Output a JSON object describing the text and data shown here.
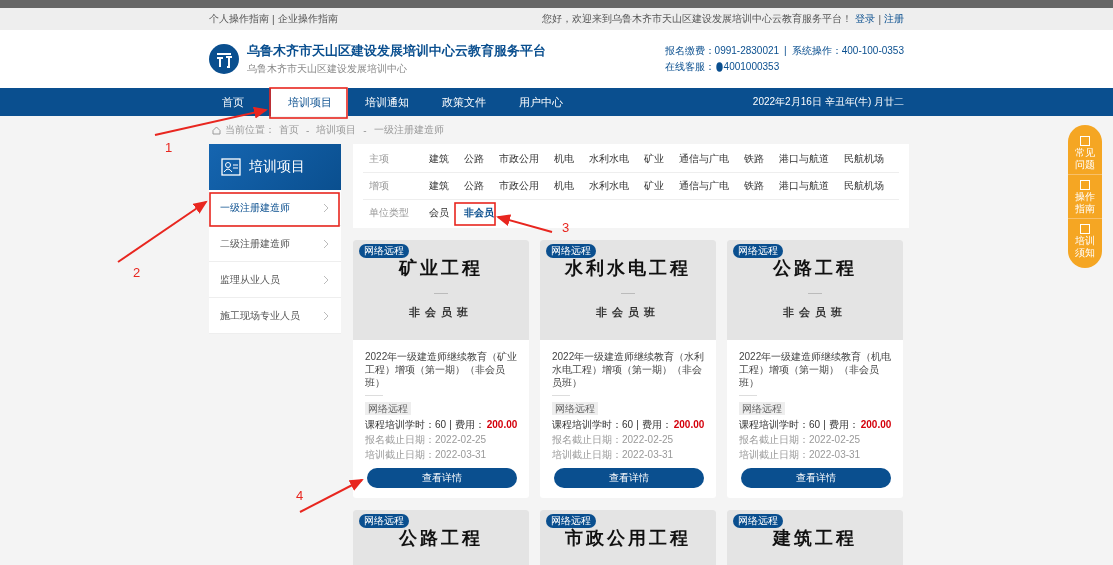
{
  "top_bar": {
    "links": [
      "个人操作指南",
      "企业操作指南"
    ],
    "separator": "|",
    "welcome": "您好，欢迎来到乌鲁木齐市天山区建设发展培训中心云教育服务平台！",
    "login": "登录",
    "register": "注册"
  },
  "header": {
    "title": "乌鲁木齐市天山区建设发展培训中心云教育服务平台",
    "subtitle": "乌鲁木齐市天山区建设发展培训中心",
    "payment": "报名缴费：0991-2830021",
    "separator": "|",
    "system": "系统操作：400-100-0353",
    "service_label": "在线客服：",
    "service_number": "4001000353"
  },
  "nav": {
    "items": [
      {
        "label": "首页",
        "selected": false
      },
      {
        "label": "培训项目",
        "selected": true
      },
      {
        "label": "培训通知",
        "selected": false
      },
      {
        "label": "政策文件",
        "selected": false
      },
      {
        "label": "用户中心",
        "selected": false
      }
    ],
    "date": "2022年2月16日 辛丑年(牛) 月廿二"
  },
  "breadcrumb": {
    "label": "当前位置：",
    "separator": "-",
    "items": [
      "首页",
      "培训项目",
      "一级注册建造师"
    ]
  },
  "sidebar": {
    "title": "培训项目",
    "items": [
      {
        "label": "一级注册建造师",
        "selected": true
      },
      {
        "label": "二级注册建造师",
        "selected": false
      },
      {
        "label": "监理从业人员",
        "selected": false
      },
      {
        "label": "施工现场专业人员",
        "selected": false
      }
    ]
  },
  "filters": [
    {
      "label": "主项",
      "options": [
        {
          "label": "建筑",
          "selected": false
        },
        {
          "label": "公路",
          "selected": false
        },
        {
          "label": "市政公用",
          "selected": false
        },
        {
          "label": "机电",
          "selected": false
        },
        {
          "label": "水利水电",
          "selected": false
        },
        {
          "label": "矿业",
          "selected": false
        },
        {
          "label": "通信与广电",
          "selected": false
        },
        {
          "label": "铁路",
          "selected": false
        },
        {
          "label": "港口与航道",
          "selected": false
        },
        {
          "label": "民航机场",
          "selected": false
        }
      ]
    },
    {
      "label": "增项",
      "options": [
        {
          "label": "建筑",
          "selected": false
        },
        {
          "label": "公路",
          "selected": false
        },
        {
          "label": "市政公用",
          "selected": false
        },
        {
          "label": "机电",
          "selected": false
        },
        {
          "label": "水利水电",
          "selected": false
        },
        {
          "label": "矿业",
          "selected": false
        },
        {
          "label": "通信与广电",
          "selected": false
        },
        {
          "label": "铁路",
          "selected": false
        },
        {
          "label": "港口与航道",
          "selected": false
        },
        {
          "label": "民航机场",
          "selected": false
        }
      ]
    },
    {
      "label": "单位类型",
      "options": [
        {
          "label": "会员",
          "selected": false
        },
        {
          "label": "非会员",
          "selected": true
        }
      ]
    }
  ],
  "cards": [
    {
      "badge": "网络远程",
      "title": "矿业工程",
      "subtitle": "非会员班",
      "description": "2022年一级建造师继续教育（矿业工程）增项（第一期）（非会员班）",
      "tag": "网络远程",
      "hours": "课程培训学时：60",
      "separator": "|",
      "fee_label": "费用：",
      "fee": "200.00",
      "signup_deadline": "报名截止日期：2022-02-25",
      "training_deadline": "培训截止日期：2022-03-31",
      "button": "查看详情"
    },
    {
      "badge": "网络远程",
      "title": "水利水电工程",
      "subtitle": "非会员班",
      "description": "2022年一级建造师继续教育（水利水电工程）增项（第一期）（非会员班）",
      "tag": "网络远程",
      "hours": "课程培训学时：60",
      "separator": "|",
      "fee_label": "费用：",
      "fee": "200.00",
      "signup_deadline": "报名截止日期：2022-02-25",
      "training_deadline": "培训截止日期：2022-03-31",
      "button": "查看详情"
    },
    {
      "badge": "网络远程",
      "title": "公路工程",
      "subtitle": "非会员班",
      "description": "2022年一级建造师继续教育（机电工程）增项（第一期）（非会员班）",
      "tag": "网络远程",
      "hours": "课程培训学时：60",
      "separator": "|",
      "fee_label": "费用：",
      "fee": "200.00",
      "signup_deadline": "报名截止日期：2022-02-25",
      "training_deadline": "培训截止日期：2022-03-31",
      "button": "查看详情"
    },
    {
      "badge": "网络远程",
      "title": "公路工程"
    },
    {
      "badge": "网络远程",
      "title": "市政公用工程"
    },
    {
      "badge": "网络远程",
      "title": "建筑工程"
    }
  ],
  "side_widget": [
    "常见问题",
    "操作指南",
    "培训须知"
  ],
  "annotations": [
    "1",
    "2",
    "3",
    "4"
  ]
}
